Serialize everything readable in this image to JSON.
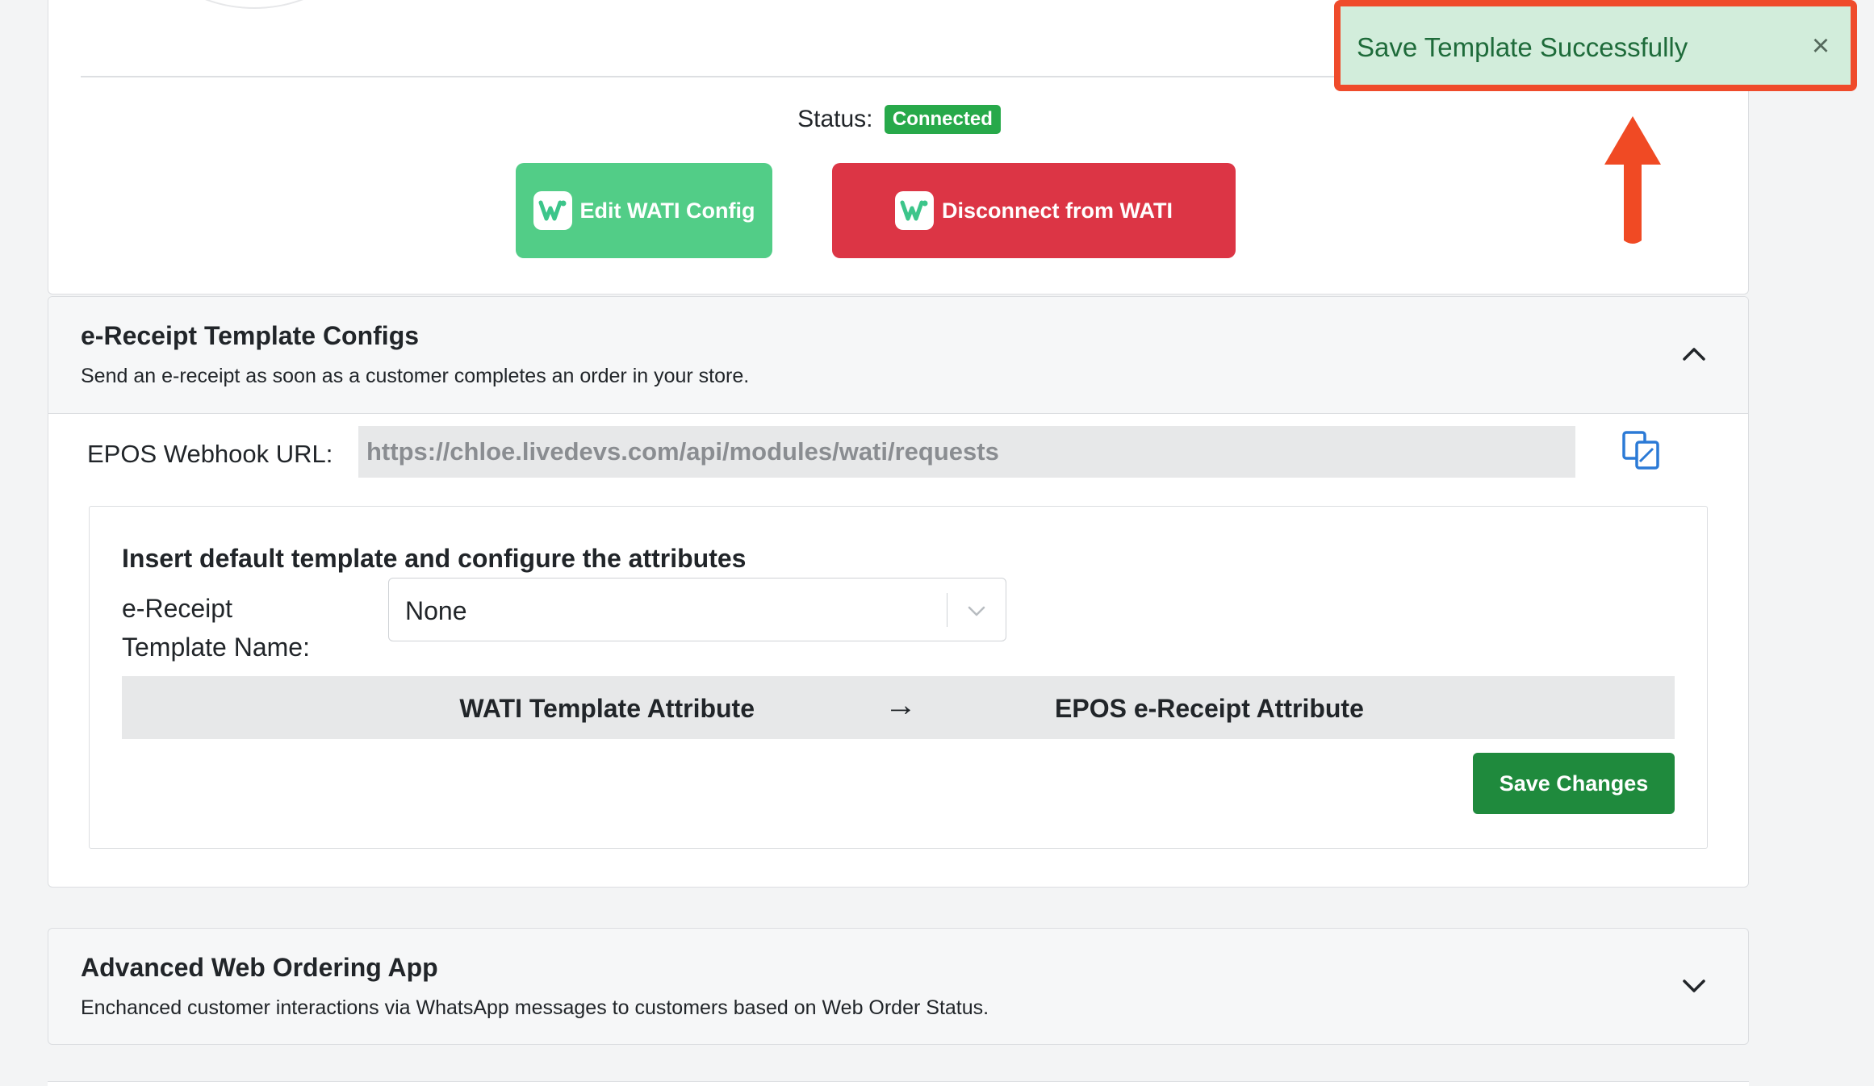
{
  "toast": {
    "message": "Save Template Successfully",
    "close_symbol": "×"
  },
  "connection": {
    "status_label": "Status:",
    "status_value": "Connected",
    "edit_button_label": "Edit WATI Config",
    "disconnect_button_label": "Disconnect from WATI"
  },
  "receipt_section": {
    "title": "e-Receipt Template Configs",
    "subtitle": "Send an e-receipt as soon as a customer completes an order in your store.",
    "webhook_label": "EPOS Webhook URL:",
    "webhook_url": "https://chloe.livedevs.com/api/modules/wati/requests",
    "inner_title": "Insert default template and configure the attributes",
    "template_name_label": "e-Receipt Template Name:",
    "template_name_value": "None",
    "attr_left_header": "WATI Template Attribute",
    "attr_arrow": "→",
    "attr_right_header": "EPOS e-Receipt Attribute",
    "save_button_label": "Save Changes"
  },
  "advanced_section": {
    "title": "Advanced Web Ordering App",
    "subtitle": "Enchanced customer interactions via WhatsApp messages to customers based on Web Order Status."
  },
  "colors": {
    "connected_badge": "#27a94a",
    "edit_button": "#52cd87",
    "disconnect_button": "#dc3545",
    "save_button": "#1f8a3d",
    "toast_background": "#d2eddb",
    "highlight": "#ef4b2b"
  }
}
